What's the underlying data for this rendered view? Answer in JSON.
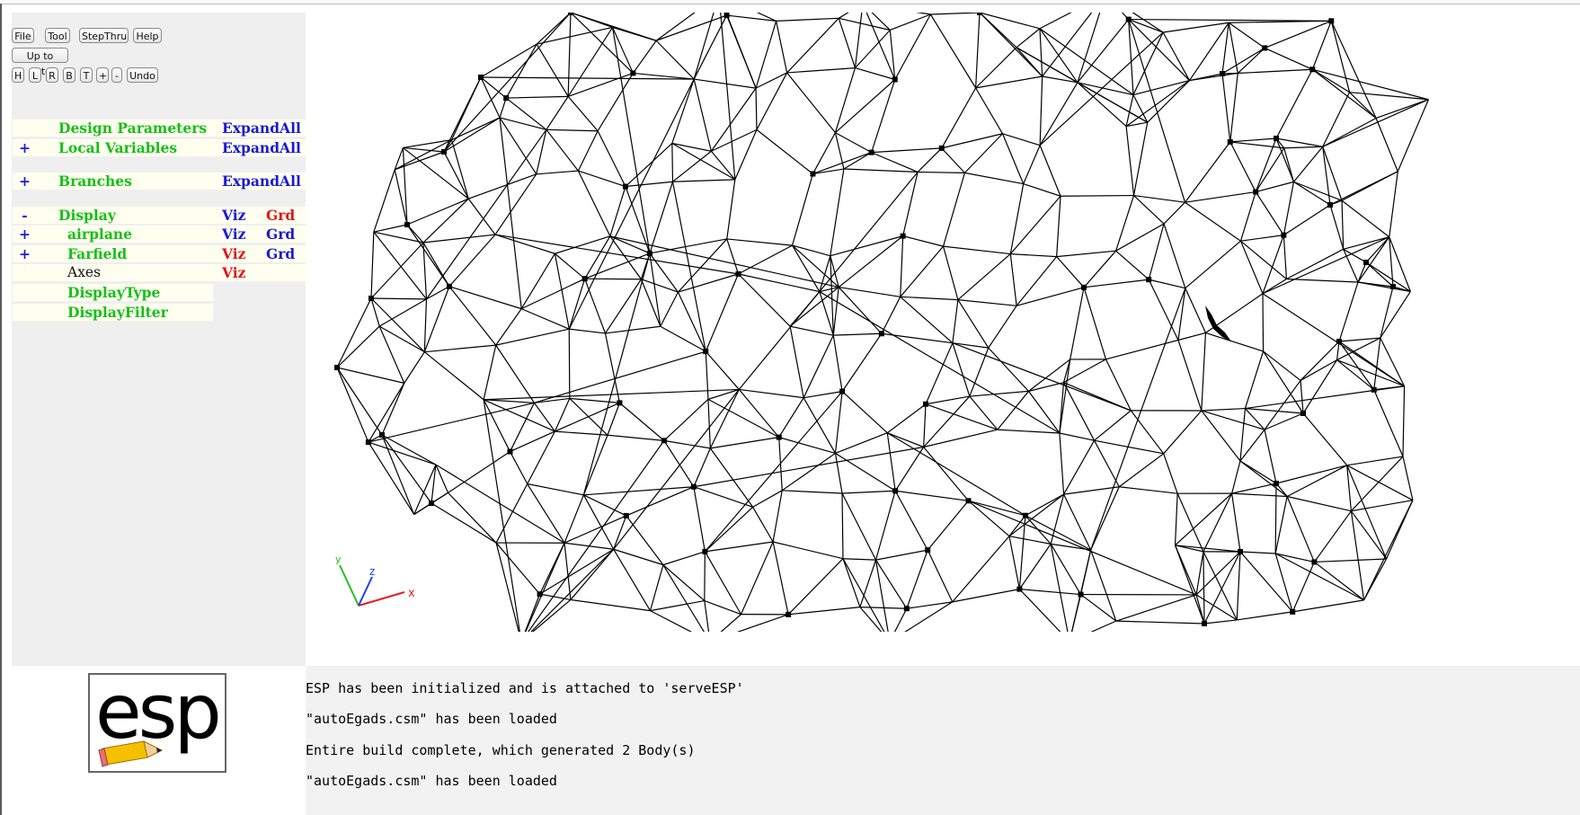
{
  "toolbar": {
    "file": "File",
    "tool": "Tool",
    "stepthru": "StepThru",
    "help": "Help",
    "up_to_date": "Up to date",
    "view_buttons": [
      "H",
      "L",
      "R",
      "B",
      "T",
      "+",
      "-"
    ],
    "undo": "Undo"
  },
  "tree": {
    "design_parameters": {
      "toggle": "",
      "label": "Design Parameters",
      "action": "ExpandAll"
    },
    "local_variables": {
      "toggle": "+",
      "label": "Local Variables",
      "action": "ExpandAll"
    },
    "branches": {
      "toggle": "+",
      "label": "Branches",
      "action": "ExpandAll"
    },
    "display": {
      "toggle": "-",
      "label": "Display",
      "viz": "Viz",
      "grd": "Grd"
    },
    "airplane": {
      "toggle": "+",
      "label": "airplane",
      "viz": "Viz",
      "grd": "Grd"
    },
    "farfield": {
      "toggle": "+",
      "label": "Farfield",
      "viz": "Viz",
      "grd": "Grd"
    },
    "axes": {
      "label": "Axes",
      "viz": "Viz"
    },
    "display_type": {
      "label": "DisplayType"
    },
    "display_filter": {
      "label": "DisplayFilter"
    }
  },
  "axes_triad": {
    "x": "x",
    "y": "y",
    "z": "z"
  },
  "logo": {
    "text": "esp"
  },
  "messages": [
    "ESP has been initialized and is attached to 'serveESP'",
    "\"autoEgads.csm\" has been loaded",
    "Entire build complete, which generated 2 Body(s)",
    "\"autoEgads.csm\" has been loaded"
  ],
  "colors": {
    "tree_green": "#16c016",
    "tree_blue": "#1a1ad6",
    "tree_red": "#e01818",
    "tree_cell_bg": "#fffff0",
    "panel_bg": "#efefef",
    "message_bg": "#f2f2f2",
    "axis_x": "#e02020",
    "axis_y": "#20c020",
    "axis_z": "#2040e0",
    "mesh": "#000000"
  }
}
